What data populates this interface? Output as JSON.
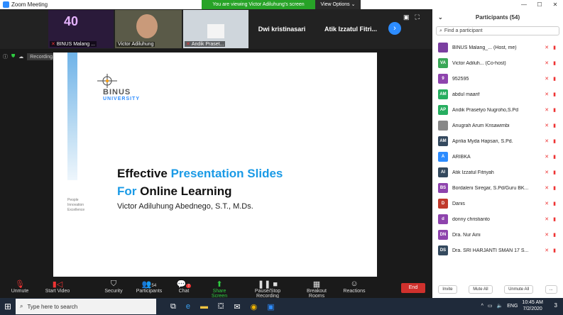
{
  "window": {
    "title": "Zoom Meeting"
  },
  "banner": {
    "viewing": "You are viewing Victor Adiluhung's screen",
    "view_options": "View Options ⌄"
  },
  "thumbs": [
    {
      "name": "BINUS Malang ..."
    },
    {
      "name": "Victor Adiluhung"
    },
    {
      "name": "Andik Praset..."
    },
    {
      "name": "Dwi kristinasari"
    },
    {
      "name": "Atik Izzatul Fitri..."
    }
  ],
  "recording": {
    "label": "Recording..."
  },
  "slide": {
    "logo_title": "BINUS",
    "logo_sub": "UNIVERSITY",
    "tagline": [
      "People",
      "Innovation",
      "Excellence"
    ],
    "title1_a": "Effective ",
    "title1_b": "Presentation Slides",
    "title2_a": "For ",
    "title2_b": "Online Learning",
    "author": "Victor Adiluhung Abednego, S.T., M.Ds."
  },
  "toolbar": {
    "unmute": "Unmute",
    "start_video": "Start Video",
    "security": "Security",
    "participants": "Participants",
    "participants_count": "54",
    "chat": "Chat",
    "chat_badge": "2",
    "share": "Share Screen",
    "record": "Pause/Stop Recording",
    "breakout": "Breakout Rooms",
    "reactions": "Reactions",
    "end": "End"
  },
  "panel": {
    "title": "Participants (54)",
    "search_placeholder": "Find a participant",
    "participants": [
      {
        "initials": "",
        "name": "BINUS Malang_...  (Host, me)",
        "color": "#7b3fa0"
      },
      {
        "initials": "VA",
        "name": "Victor Adiluh...  (Co-host)",
        "color": "#3aa757"
      },
      {
        "initials": "9",
        "name": "952595",
        "color": "#8e44ad"
      },
      {
        "initials": "AM",
        "name": "abdul maarif",
        "color": "#27ae60"
      },
      {
        "initials": "AP",
        "name": "Andik Prasetyo Nugroho,S.Pd",
        "color": "#27ae60"
      },
      {
        "initials": "",
        "name": "Anugrah Arum Krisawimbi",
        "color": "#888888"
      },
      {
        "initials": "AM",
        "name": "Aprilia Myda Hapsari, S.Pd.",
        "color": "#34495e"
      },
      {
        "initials": "A",
        "name": "ARIBKA",
        "color": "#2d8cff"
      },
      {
        "initials": "AI",
        "name": "Atik Izzatul Fitriyah",
        "color": "#34495e"
      },
      {
        "initials": "BS",
        "name": "Bordaleni Siregar, S.Pd/Guru BK...",
        "color": "#8e44ad"
      },
      {
        "initials": "D",
        "name": "Danis",
        "color": "#c0392b"
      },
      {
        "initials": "d",
        "name": "donny christianto",
        "color": "#8e44ad"
      },
      {
        "initials": "DN",
        "name": "Dra. Nur Aini",
        "color": "#8e44ad"
      },
      {
        "initials": "DS",
        "name": "Dra. SRI HARJANTI SMAN 17 S...",
        "color": "#34495e"
      }
    ],
    "invite": "Invite",
    "mute_all": "Mute All",
    "unmute_all": "Unmute All",
    "more": "..."
  },
  "taskbar": {
    "search": "Type here to search",
    "time": "10:45 AM",
    "date": "7/2/2020",
    "notif": "3"
  }
}
